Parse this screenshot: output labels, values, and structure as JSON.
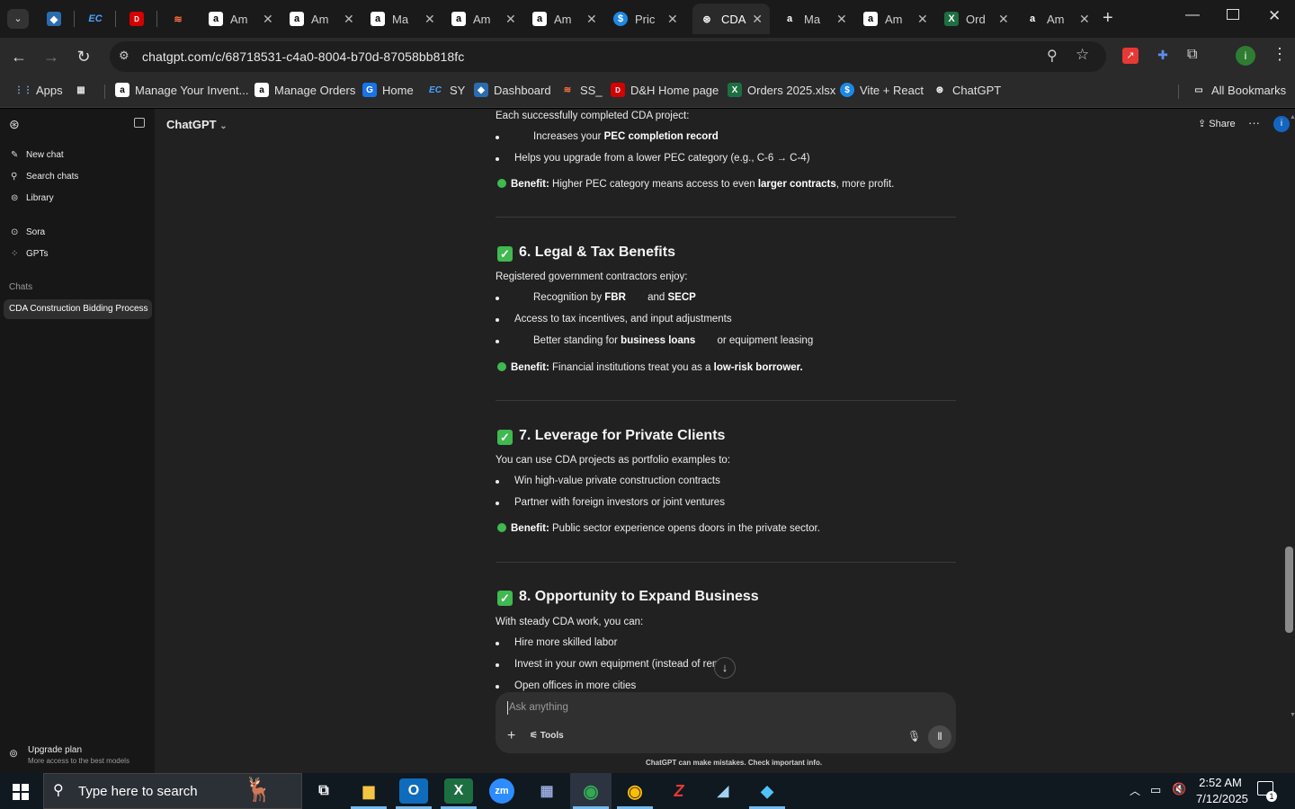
{
  "browser": {
    "tabs": [
      {
        "label": "",
        "icon": "cube-app-icon",
        "color": "#2b6cb0"
      },
      {
        "label": "",
        "icon": "ec-logo-icon",
        "color": "#1a73e8"
      },
      {
        "label": "",
        "icon": "daraz-icon",
        "color": "#d50000"
      },
      {
        "label": "",
        "icon": "layers-icon",
        "color": "#ff7043"
      },
      {
        "label": "Am",
        "icon": "amazon-icon"
      },
      {
        "label": "Am",
        "icon": "amazon-icon"
      },
      {
        "label": "Ma",
        "icon": "amazon-icon"
      },
      {
        "label": "Am",
        "icon": "amazon-icon"
      },
      {
        "label": "Am",
        "icon": "amazon-icon"
      },
      {
        "label": "Pric",
        "icon": "dollar-icon"
      },
      {
        "label": "CDA",
        "icon": "chatgpt-icon",
        "active": true
      },
      {
        "label": "Ma",
        "icon": "amazon-icon"
      },
      {
        "label": "Am",
        "icon": "amazon-icon"
      },
      {
        "label": "Ord",
        "icon": "excel-icon"
      },
      {
        "label": "Am",
        "icon": "amazon-icon"
      }
    ],
    "url": "chatgpt.com/c/68718531-c4a0-8004-b70d-87058bb818fc",
    "bookmarks": [
      {
        "label": "Apps"
      },
      {
        "label": ""
      },
      {
        "label": "Manage Your Invent..."
      },
      {
        "label": "Manage Orders"
      },
      {
        "label": "Home"
      },
      {
        "label": "SY"
      },
      {
        "label": "Dashboard"
      },
      {
        "label": "SS_"
      },
      {
        "label": "D&H Home page"
      },
      {
        "label": "Orders 2025.xlsx"
      },
      {
        "label": "Vite + React"
      },
      {
        "label": "ChatGPT"
      }
    ],
    "all_bookmarks": "All Bookmarks"
  },
  "sidebar": {
    "new_chat": "New chat",
    "search_chats": "Search chats",
    "library": "Library",
    "sora": "Sora",
    "gpts": "GPTs",
    "chats_heading": "Chats",
    "active_chat": "CDA Construction Bidding Process",
    "upgrade_title": "Upgrade plan",
    "upgrade_sub": "More access to the best models"
  },
  "header": {
    "model": "ChatGPT",
    "share": "Share"
  },
  "content": {
    "intro5": "Each successfully completed CDA project:",
    "b5_1a": "Increases your ",
    "b5_1b": "PEC completion record",
    "b5_2": "Helps you upgrade from a lower PEC category (e.g., C-6 → C-4)",
    "ben5_label": "Benefit:",
    "ben5a": " Higher PEC category means access to even ",
    "ben5b": "larger contracts",
    "ben5c": ", more profit.",
    "h6": "6. Legal & Tax Benefits",
    "intro6": "Registered government contractors enjoy:",
    "b6_1a": "Recognition by ",
    "b6_1b": "FBR",
    "b6_1c": " and ",
    "b6_1d": "SECP",
    "b6_2": "Access to tax incentives, and input adjustments",
    "b6_3a": "Better standing for ",
    "b6_3b": "business loans",
    "b6_3c": " or equipment leasing",
    "ben6_label": "Benefit:",
    "ben6a": " Financial institutions treat you as a ",
    "ben6b": "low-risk borrower.",
    "h7": "7. Leverage for Private Clients",
    "intro7": "You can use CDA projects as portfolio examples to:",
    "b7_1": "Win high-value private construction contracts",
    "b7_2": "Partner with foreign investors or joint ventures",
    "ben7_label": "Benefit:",
    "ben7a": " Public sector experience opens doors in the private sector.",
    "h8": "8. Opportunity to Expand Business",
    "intro8": "With steady CDA work, you can:",
    "b8_1": "Hire more skilled labor",
    "b8_2": "Invest in your own equipment (instead of rental)",
    "b8_3": "Open offices in more cities"
  },
  "composer": {
    "placeholder": "Ask anything",
    "tools": "Tools",
    "disclaimer": "ChatGPT can make mistakes. Check important info."
  },
  "taskbar": {
    "search_placeholder": "Type here to search",
    "time": "2:52 AM",
    "date": "7/12/2025",
    "notif_count": "1"
  }
}
